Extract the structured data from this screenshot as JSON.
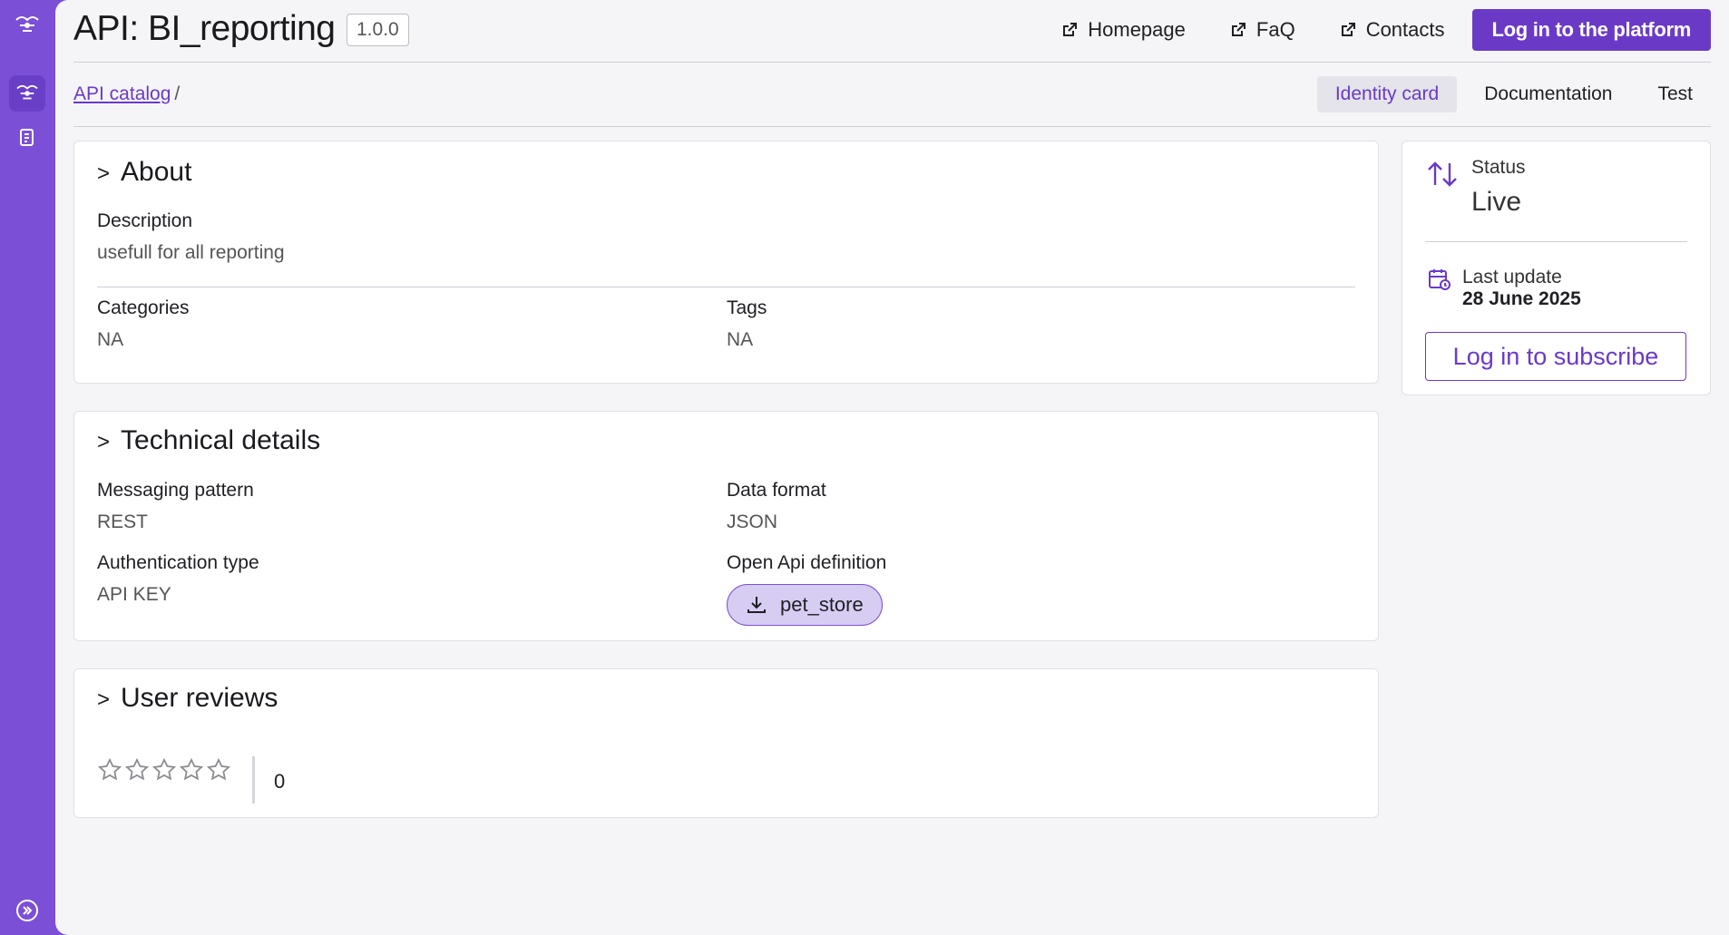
{
  "app": {
    "accent": "#7b4fd6",
    "primary": "#6a3ac7"
  },
  "header": {
    "title": "API: BI_reporting",
    "version": "1.0.0",
    "links": [
      {
        "label": "Homepage",
        "icon": "external-link-icon"
      },
      {
        "label": "FaQ",
        "icon": "external-link-icon"
      },
      {
        "label": "Contacts",
        "icon": "external-link-icon"
      }
    ],
    "login_label": "Log in to the platform"
  },
  "breadcrumb": {
    "link": "API catalog",
    "separator": "/"
  },
  "tabs": [
    {
      "label": "Identity card",
      "active": true
    },
    {
      "label": "Documentation",
      "active": false
    },
    {
      "label": "Test",
      "active": false
    }
  ],
  "about": {
    "chevron": ">",
    "title": "About",
    "description_label": "Description",
    "description_value": "usefull for all reporting",
    "categories_label": "Categories",
    "categories_value": "NA",
    "tags_label": "Tags",
    "tags_value": "NA"
  },
  "technical": {
    "chevron": ">",
    "title": "Technical details",
    "messaging_label": "Messaging pattern",
    "messaging_value": "REST",
    "format_label": "Data format",
    "format_value": "JSON",
    "auth_label": "Authentication type",
    "auth_value": "API KEY",
    "openapi_label": "Open Api definition",
    "openapi_file": "pet_store"
  },
  "reviews": {
    "chevron": ">",
    "title": "User reviews",
    "rating": 0,
    "max_rating": 5,
    "count": "0"
  },
  "status_panel": {
    "status_label": "Status",
    "status_value": "Live",
    "update_label": "Last update",
    "update_value": "28 June 2025",
    "subscribe_label": "Log in to subscribe"
  }
}
